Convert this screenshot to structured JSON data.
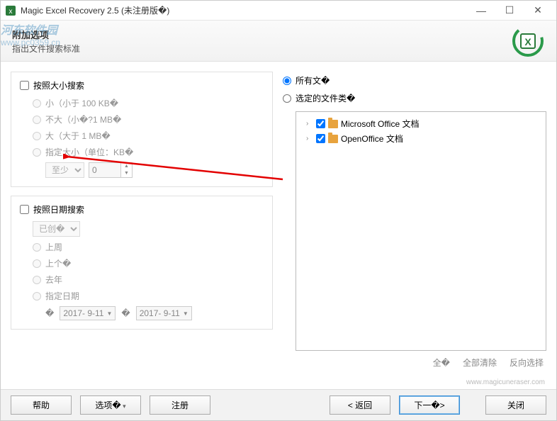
{
  "titlebar": {
    "title": "Magic Excel Recovery 2.5 (未注册版�)"
  },
  "header": {
    "title": "附加选项",
    "subtitle": "指出文件搜索标准"
  },
  "watermark": {
    "line1": "河东软件园",
    "line2": "www.pc0359.cn"
  },
  "size_group": {
    "title": "按照大小搜索",
    "opt_small": "小（小于 100 KB�",
    "opt_medium": "不大（小�?1 MB�",
    "opt_large": "大（大于 1 MB�",
    "opt_custom": "指定大小（单位：KB�",
    "select_label": "至少",
    "spin_value": "0"
  },
  "date_group": {
    "title": "按照日期搜索",
    "select_label": "已创�",
    "opt_lastweek": "上周",
    "opt_lastmonth": "上个�",
    "opt_lastyear": "去年",
    "opt_custom": "指定日期",
    "date_from_prefix": "�",
    "date_to_prefix": "�",
    "date_from": "2017- 9-11",
    "date_to": "2017- 9-11"
  },
  "type_group": {
    "opt_all": "所有文�",
    "opt_selected": "选定的文件类�",
    "items": [
      {
        "label": "Microsoft Office 文档"
      },
      {
        "label": "OpenOffice 文档"
      }
    ],
    "actions": {
      "all": "全�",
      "clear": "全部清除",
      "invert": "反向选择"
    }
  },
  "footer_url": "www.magicuneraser.com",
  "buttons": {
    "help": "帮助",
    "options": "选项�",
    "register": "注册",
    "back": "< 返回",
    "next": "下一�>",
    "close": "关闭"
  }
}
